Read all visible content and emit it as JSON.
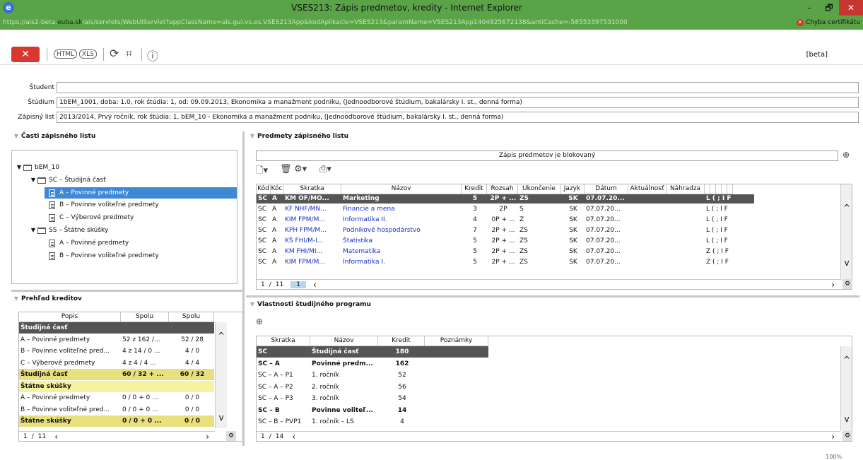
{
  "window": {
    "title": "VSES213: Zápis predmetov, kredity - Internet Explorer",
    "url_prefix": "https://ais2-beta.",
    "url_domain": "euba.sk",
    "url_rest": "/ais/servlets/WebUIServlet?appClassName=ais.gui.vs.es.VSES213App&kodAplikacie=VSES213&paramName=VSES213App1404825672138&antiCache=-58553397531000",
    "cert_error": "Chyba certifikátu",
    "minimize": "–",
    "restore": "🗗",
    "close": "✕"
  },
  "toolbar": {
    "close_label": "✕",
    "html_label": "HTML",
    "xls_label": "XLS",
    "refresh_icon": "⟳",
    "tree_icon": "⌗",
    "info_icon": "ⓘ",
    "beta": "[beta]"
  },
  "student": {
    "student_label": "Študent",
    "student_value": "",
    "studium_label": "Štúdium",
    "studium_value": "1bEM_1001, doba: 1.0, rok štúdia: 1, od: 09.09.2013, Ekonomika a manažment podniku, (Jednoodborové štúdium, bakalársky I. st., denná forma)",
    "zapisny_label": "Zápisný list",
    "zapisny_value": "2013/2014, Prvý ročník, rok štúdia: 1, bEM_10 - Ekonomika a manažment podniku, (Jednoodborové štúdium, bakalársky I. st., denná forma)"
  },
  "casti": {
    "header": "Časti zápisného listu",
    "nodes": [
      {
        "label": "bEM_10"
      },
      {
        "label": "SC – Študijná časť"
      },
      {
        "label": "A – Povinné predmety"
      },
      {
        "label": "B – Povinne voliteľné predmety"
      },
      {
        "label": "C – Výberové predmety"
      },
      {
        "label": "SS – Štátne skúšky"
      },
      {
        "label": "A – Povinné predmety"
      },
      {
        "label": "B – Povinne voliteľné predmety"
      }
    ]
  },
  "predmety": {
    "header": "Predmety zápisného listu",
    "blocked": "Zápis predmetov je blokovaný",
    "columns": [
      "Kód",
      "Kóc",
      "Skratka",
      "Názov",
      "Kredit",
      "Rozsah",
      "Ukončenie",
      "Jazyk",
      "Dátum",
      "Aktuálnosť",
      "Náhradza"
    ],
    "rows": [
      [
        "SC",
        "A",
        "KM OF/MO...",
        "Marketing",
        "5",
        "2P + ...",
        "ZS",
        "SK",
        "07.07.20...",
        "",
        "",
        "L  ( ; I  F"
      ],
      [
        "SC",
        "A",
        "KF NHF/MN...",
        "Financie a mena",
        "3",
        "2P",
        "S",
        "SK",
        "07.07.20...",
        "",
        "",
        "L  ( ; I  F"
      ],
      [
        "SC",
        "A",
        "KIM FPM/M...",
        "Informatika II.",
        "4",
        "0P + ...",
        "Z",
        "SK",
        "07.07.20...",
        "",
        "",
        "L  ( ; I  F"
      ],
      [
        "SC",
        "A",
        "KPH FPM/M...",
        "Podnikové hospodárstvo",
        "7",
        "2P + ...",
        "ZS",
        "SK",
        "07.07.20...",
        "",
        "",
        "L  ( ; I  F"
      ],
      [
        "SC",
        "A",
        "KŠ FHI/M-I...",
        "Štatistika",
        "5",
        "2P + ...",
        "ZS",
        "SK",
        "07.07.20...",
        "",
        "",
        "L  ( ; I  F"
      ],
      [
        "SC",
        "A",
        "KM FHI/MI...",
        "Matematika",
        "5",
        "2P + ...",
        "ZS",
        "SK",
        "07.07.20...",
        "",
        "",
        "Z  ( ; I  F"
      ],
      [
        "SC",
        "A",
        "KIM FPM/M...",
        "Informatika I.",
        "5",
        "2P + ...",
        "ZS",
        "SK",
        "07.07.20...",
        "",
        "",
        "Z  ( ; I  F"
      ]
    ],
    "pager_page": "1",
    "pager_sep": "/",
    "pager_total": "11",
    "pager_current": "1"
  },
  "kredity": {
    "header": "Prehľad kreditov",
    "columns": [
      "Popis",
      "Spolu",
      "Spolu"
    ],
    "rows": [
      {
        "style": "dark",
        "cells": [
          "Študijná časť",
          "",
          ""
        ]
      },
      {
        "style": "",
        "cells": [
          "A – Povinné predmety",
          "52 z 162 /...",
          "52 / 28"
        ]
      },
      {
        "style": "",
        "cells": [
          "B – Povinne voliteľné pred...",
          "4 z 14 / 0 ...",
          "4 / 0"
        ]
      },
      {
        "style": "",
        "cells": [
          "C – Výberové predmety",
          "4 z 4 / 4 ...",
          "4 / 4"
        ]
      },
      {
        "style": "yellow",
        "cells": [
          "Študijná časť",
          "60 / 32 + ...",
          "60 / 32"
        ]
      },
      {
        "style": "lightyellow",
        "cells": [
          "Štátne skúšky",
          "",
          ""
        ]
      },
      {
        "style": "",
        "cells": [
          "A – Povinné predmety",
          "0 / 0 + 0 ...",
          "0 / 0"
        ]
      },
      {
        "style": "",
        "cells": [
          "B – Povinne voliteľné pred...",
          "0 / 0 + 0 ...",
          "0 / 0"
        ]
      },
      {
        "style": "yellow",
        "cells": [
          "Štátne skúšky",
          "0 / 0 + 0 ...",
          "0 / 0"
        ]
      }
    ],
    "pager_page": "1",
    "pager_sep": "/",
    "pager_total": "11"
  },
  "vlastnosti": {
    "header": "Vlastnosti študijného programu",
    "columns": [
      "Skratka",
      "Názov",
      "Kredit",
      "Poznámky"
    ],
    "rows": [
      {
        "style": "dark",
        "cells": [
          "SC",
          "Študijná časť",
          "180",
          ""
        ]
      },
      {
        "style": "bold",
        "cells": [
          "SC – A",
          "Povinné predm...",
          "162",
          ""
        ]
      },
      {
        "style": "",
        "cells": [
          "SC – A – P1",
          "1. ročník",
          "52",
          ""
        ]
      },
      {
        "style": "",
        "cells": [
          "SC – A – P2",
          "2. ročník",
          "56",
          ""
        ]
      },
      {
        "style": "",
        "cells": [
          "SC – A – P3",
          "3. ročník",
          "54",
          ""
        ]
      },
      {
        "style": "bold",
        "cells": [
          "SC – B",
          "Povinne voliteľ...",
          "14",
          ""
        ]
      },
      {
        "style": "",
        "cells": [
          "SC – B – PVP1",
          "1. ročník – LS",
          "4",
          ""
        ]
      }
    ],
    "pager_page": "1",
    "pager_sep": "/",
    "pager_total": "14"
  },
  "status": {
    "zoom": "100%"
  }
}
